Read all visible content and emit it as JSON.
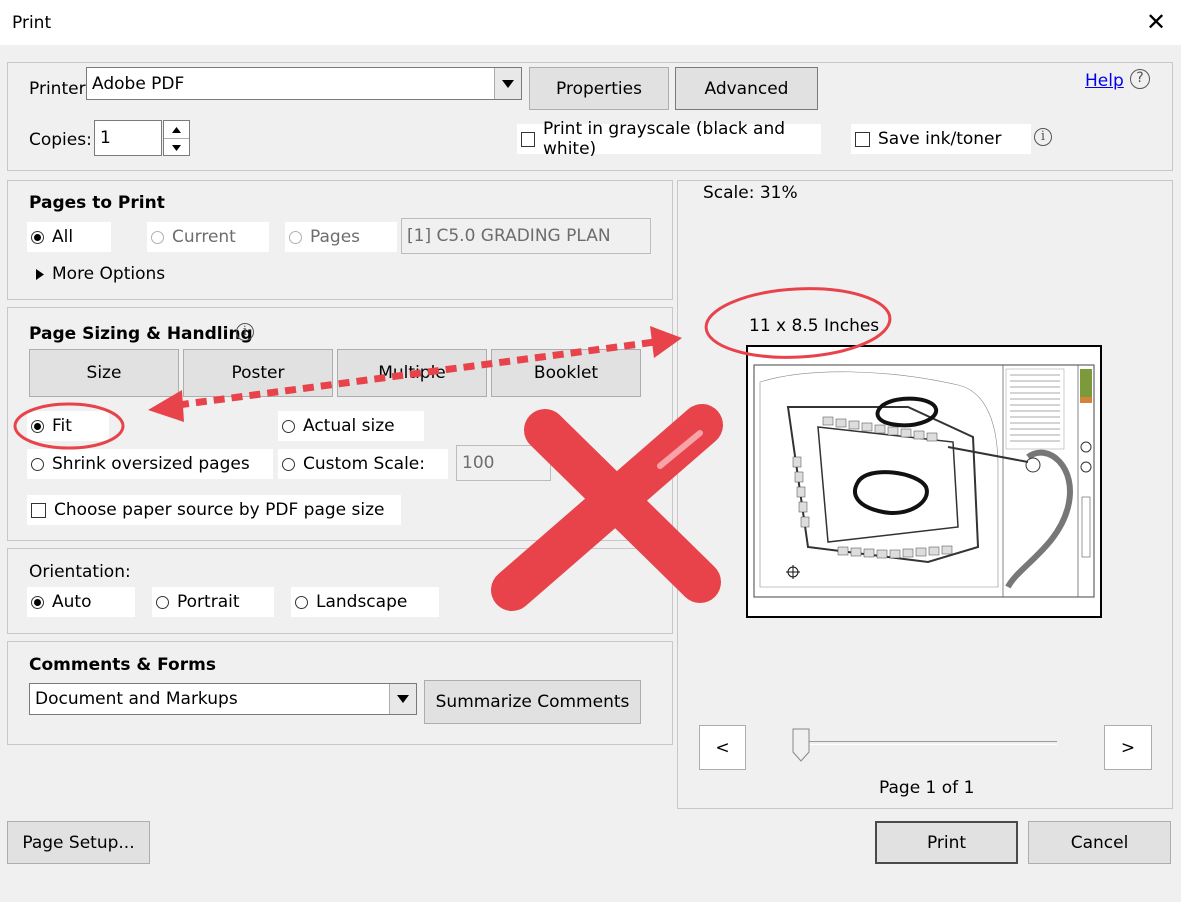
{
  "window": {
    "title": "Print",
    "close_glyph": "✕"
  },
  "printer": {
    "label": "Printer:",
    "value": "Adobe PDF",
    "properties_label": "Properties",
    "advanced_label": "Advanced",
    "help_label": "Help",
    "copies_label": "Copies:",
    "copies_value": "1",
    "grayscale_label": "Print in grayscale (black and white)",
    "grayscale_checked": false,
    "save_ink_label": "Save ink/toner",
    "save_ink_checked": false
  },
  "pages_to_print": {
    "heading": "Pages to Print",
    "options": [
      "All",
      "Current",
      "Pages"
    ],
    "selected": "All",
    "pages_value": "[1] C5.0 GRADING PLAN",
    "more_options_label": "More Options"
  },
  "page_sizing": {
    "heading": "Page Sizing & Handling",
    "tabs": [
      "Size",
      "Poster",
      "Multiple",
      "Booklet"
    ],
    "fit_label": "Fit",
    "actual_size_label": "Actual size",
    "shrink_label": "Shrink oversized pages",
    "custom_scale_label": "Custom Scale:",
    "custom_scale_value": "100",
    "selected": "Fit",
    "paper_source_label": "Choose paper source by PDF page size",
    "paper_source_checked": false
  },
  "orientation": {
    "heading": "Orientation:",
    "options": [
      "Auto",
      "Portrait",
      "Landscape"
    ],
    "selected": "Auto"
  },
  "comments_forms": {
    "heading": "Comments & Forms",
    "value": "Document and Markups",
    "summarize_label": "Summarize Comments"
  },
  "preview": {
    "scale_text": "Scale:  31%",
    "paper_size": "11 x 8.5 Inches",
    "prev_label": "<",
    "next_label": ">",
    "page_text": "Page 1 of 1",
    "slider_position": 0
  },
  "footer": {
    "page_setup_label": "Page Setup...",
    "print_label": "Print",
    "cancel_label": "Cancel"
  },
  "annotations": {
    "color": "#e8434b"
  }
}
